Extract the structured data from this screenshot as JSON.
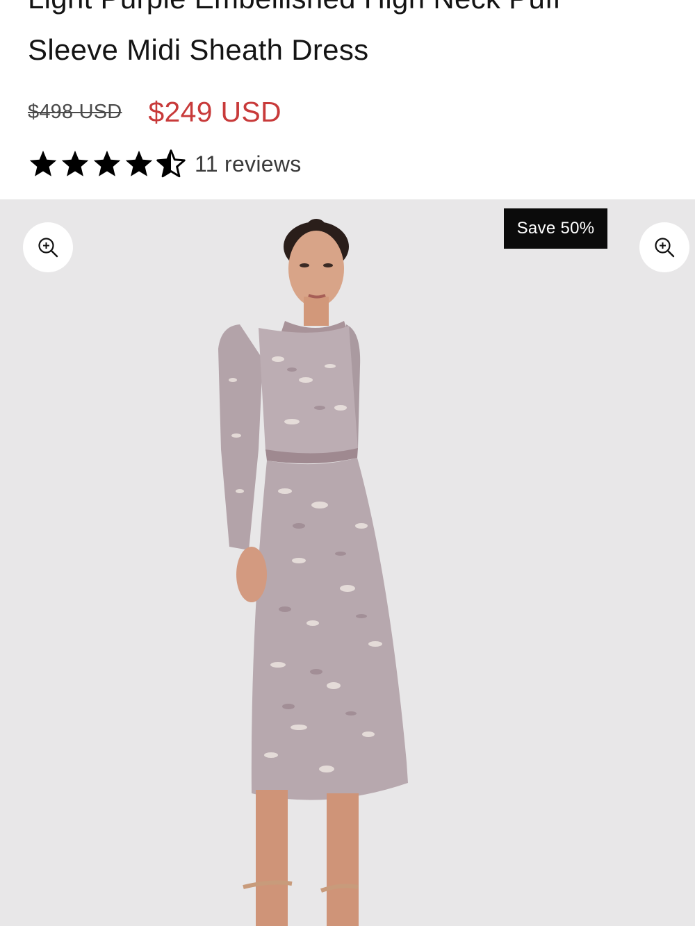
{
  "product": {
    "title_line_1": "Light Purple Embellished High Neck Puff",
    "title_line_2": "Sleeve Midi Sheath Dress",
    "compare_price": "$498 USD",
    "sale_price": "$249 USD",
    "rating": 4.5,
    "rating_max": 5,
    "reviews_label": "11 reviews"
  },
  "gallery": {
    "badge": "Save 50%",
    "zoom_icon": "zoom-in-icon",
    "image_alt": "Model wearing light purple embellished long sleeve midi dress"
  },
  "colors": {
    "sale_price": "#c83a3a",
    "badge_bg": "#0b0b0b",
    "gallery_bg": "#e8e7e8",
    "dress": "#b7a8ae"
  }
}
